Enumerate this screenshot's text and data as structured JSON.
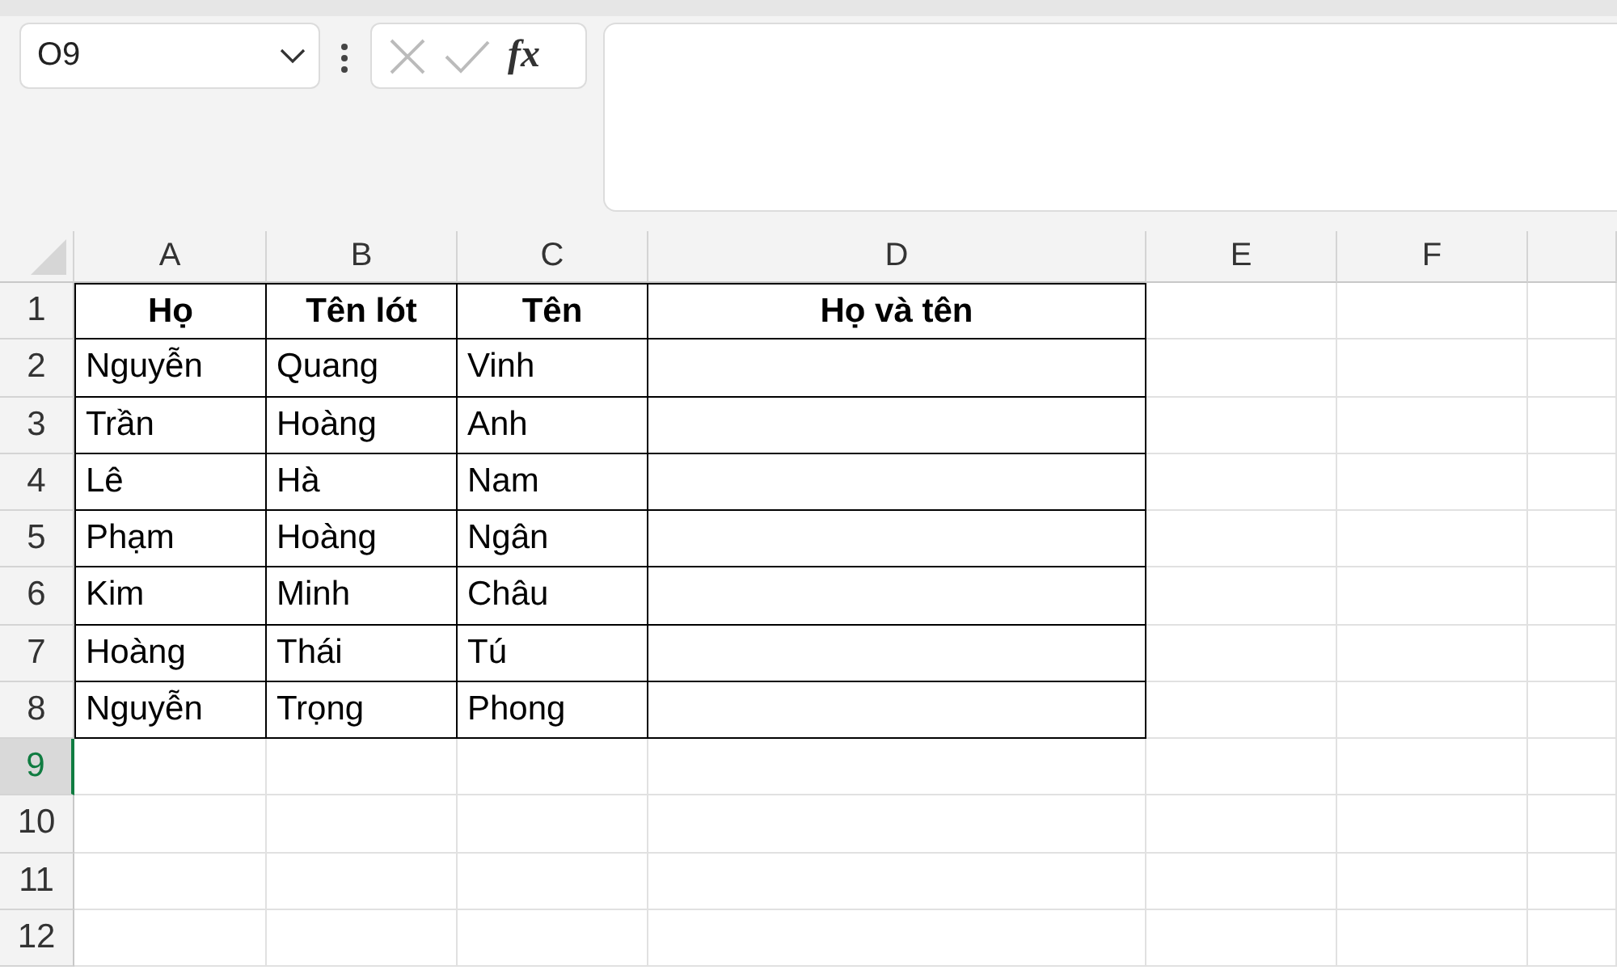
{
  "name_box": {
    "value": "O9"
  },
  "formula_bar": {
    "fx": "fx"
  },
  "columns": [
    {
      "label": "A"
    },
    {
      "label": "B"
    },
    {
      "label": "C"
    },
    {
      "label": "D"
    },
    {
      "label": "E"
    },
    {
      "label": "F"
    },
    {}
  ],
  "rows": [
    {
      "number": "1",
      "selected": false,
      "kind": "header",
      "cells": [
        "Họ",
        "Tên lót",
        "Tên",
        "Họ và tên"
      ]
    },
    {
      "number": "2",
      "selected": false,
      "kind": "data",
      "cells": [
        "Nguyễn",
        "Quang",
        "Vinh"
      ]
    },
    {
      "number": "3",
      "selected": false,
      "kind": "data",
      "cells": [
        "Trần",
        "Hoàng",
        "Anh"
      ]
    },
    {
      "number": "4",
      "selected": false,
      "kind": "data",
      "cells": [
        "Lê",
        "Hà",
        "Nam"
      ]
    },
    {
      "number": "5",
      "selected": false,
      "kind": "data",
      "cells": [
        "Phạm",
        "Hoàng",
        "Ngân"
      ]
    },
    {
      "number": "6",
      "selected": false,
      "kind": "data",
      "cells": [
        "Kim",
        "Minh",
        "Châu"
      ]
    },
    {
      "number": "7",
      "selected": false,
      "kind": "data",
      "cells": [
        "Hoàng",
        "Thái",
        "Tú"
      ]
    },
    {
      "number": "8",
      "selected": false,
      "kind": "data",
      "cells": [
        "Nguyễn",
        "Trọng",
        "Phong"
      ]
    },
    {
      "number": "9",
      "selected": true,
      "kind": "blank"
    },
    {
      "number": "10",
      "selected": false,
      "kind": "blank"
    },
    {
      "number": "11",
      "selected": false,
      "kind": "blank"
    },
    {
      "number": "12",
      "selected": false,
      "kind": "blank"
    }
  ]
}
